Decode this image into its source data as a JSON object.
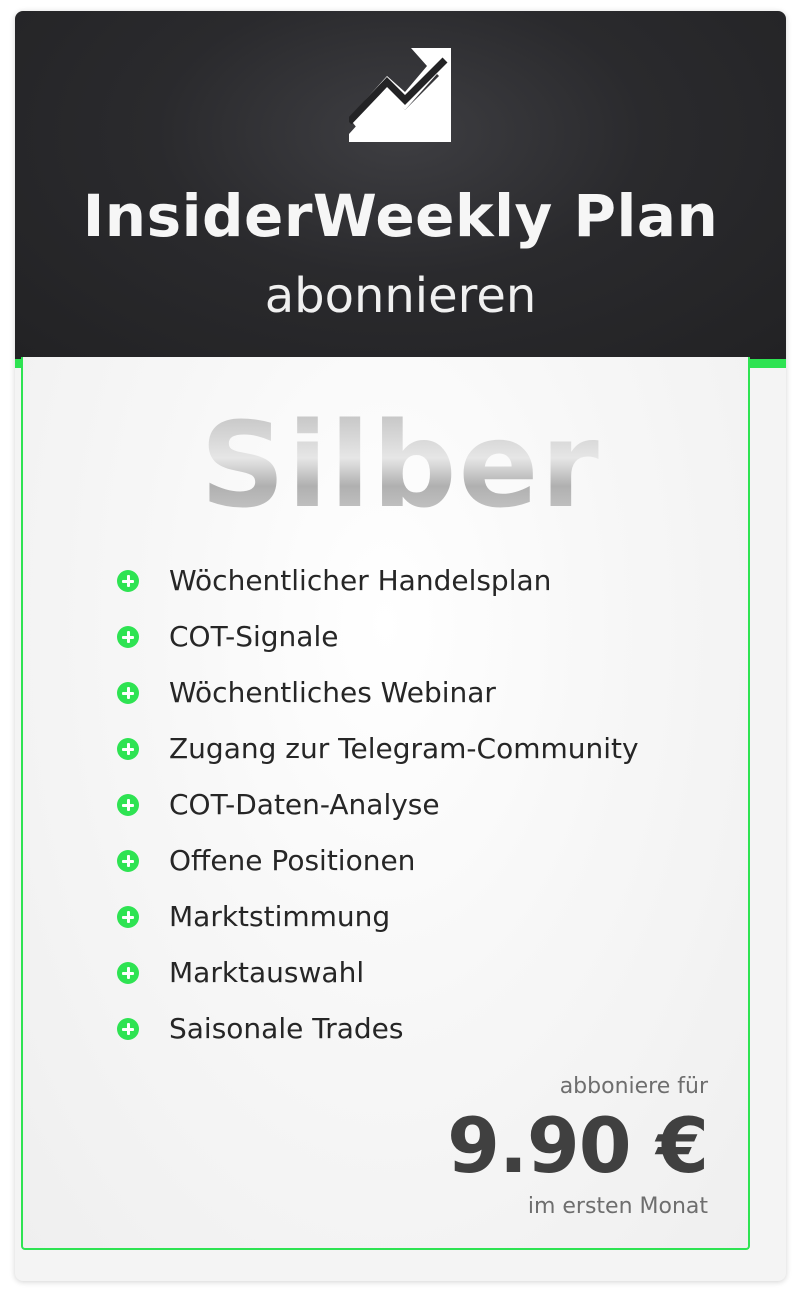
{
  "header": {
    "icon": "trending-up-chart-icon",
    "title": "InsiderWeekly Plan",
    "subtitle": "abonnieren"
  },
  "tier": {
    "name": "Silber"
  },
  "features": [
    "Wöchentlicher Handelsplan",
    "COT-Signale",
    "Wöchentliches Webinar",
    "Zugang zur Telegram-Community",
    "COT-Daten-Analyse",
    "Offene Positionen",
    "Marktstimmung",
    "Marktauswahl",
    "Saisonale Trades"
  ],
  "feature_icon": "plus-circle-icon",
  "pricing": {
    "intro": "abboniere für",
    "price": "9.90 €",
    "note": "im ersten Monat"
  },
  "colors": {
    "header_bg": "#232325",
    "accent": "#2ee352",
    "price_text": "#404040",
    "muted_text": "#6e6e6e"
  }
}
